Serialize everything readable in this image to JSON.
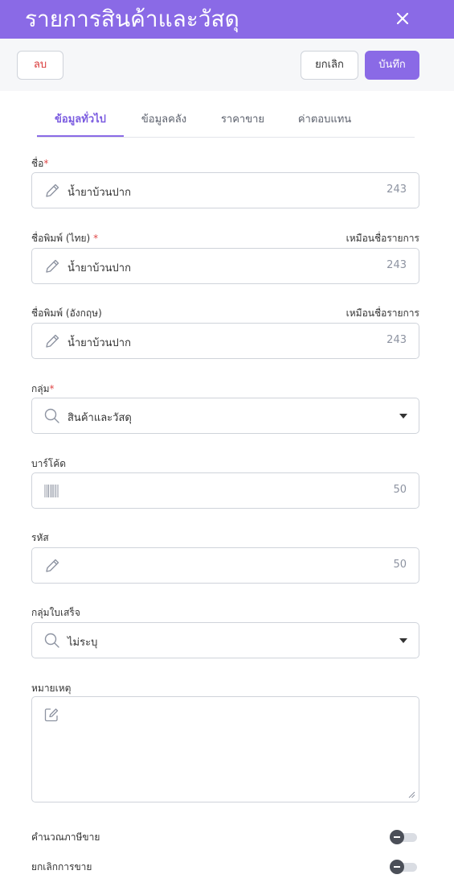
{
  "header": {
    "title": "รายการสินค้าและวัสดุ"
  },
  "toolbar": {
    "delete_label": "ลบ",
    "cancel_label": "ยกเลิก",
    "save_label": "บันทึก"
  },
  "tabs": [
    {
      "label": "ข้อมูลทั่วไป",
      "active": true
    },
    {
      "label": "ข้อมูลคลัง",
      "active": false
    },
    {
      "label": "ราคาขาย",
      "active": false
    },
    {
      "label": "ค่าตอบแทน",
      "active": false
    }
  ],
  "form": {
    "name": {
      "label": "ชื่อ",
      "required": "*",
      "value": "น้ำยาบ้วนปาก",
      "count": "243"
    },
    "print_name_th": {
      "label": "ชื่อพิมพ์ (ไทย)",
      "required": "*",
      "same_as_label": "เหมือนชื่อรายการ",
      "value": "น้ำยาบ้วนปาก",
      "count": "243"
    },
    "print_name_en": {
      "label": "ชื่อพิมพ์ (อังกฤษ)",
      "same_as_label": "เหมือนชื่อรายการ",
      "value": "น้ำยาบ้วนปาก",
      "count": "243"
    },
    "group": {
      "label": "กลุ่ม",
      "required": "*",
      "value": "สินค้าและวัสดุ"
    },
    "barcode": {
      "label": "บาร์โค้ด",
      "value": "",
      "count": "50"
    },
    "code": {
      "label": "รหัส",
      "value": "",
      "count": "50"
    },
    "receipt_group": {
      "label": "กลุ่มใบเสร็จ",
      "value": "ไม่ระบุ"
    },
    "note": {
      "label": "หมายเหตุ",
      "value": ""
    }
  },
  "toggles": {
    "sales_tax": {
      "label": "คำนวณภาษีขาย",
      "on": false
    },
    "cancel_sale": {
      "label": "ยกเลิกการขาย",
      "on": false
    }
  },
  "colors": {
    "accent": "#8a6ae6",
    "danger": "#d93636"
  }
}
